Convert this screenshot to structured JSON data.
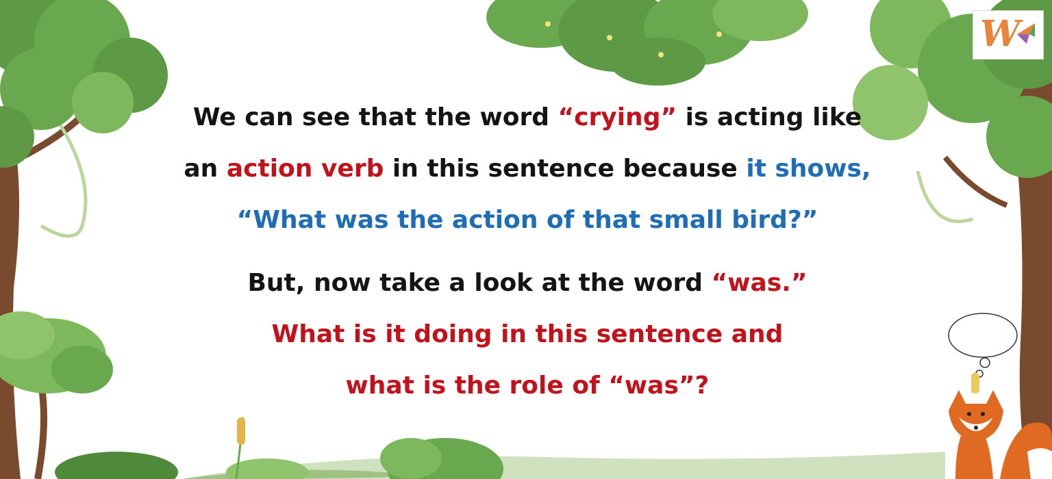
{
  "logo": {
    "letter": "W"
  },
  "text": {
    "line1": {
      "a": "We can see that the word ",
      "b": "“crying”",
      "c": " is acting like"
    },
    "line2": {
      "a": "an ",
      "b": "action verb",
      "c": " in this sentence because ",
      "d": "it shows,"
    },
    "line3": "“What was the action of that small bird?”",
    "line4": {
      "a": "But, now take a look at the word ",
      "b": "“was.”"
    },
    "line5": "What is it doing in this sentence and",
    "line6": "what is the role of “was”?"
  },
  "colors": {
    "text": "#141414",
    "highlight_red": "#c2121b",
    "highlight_blue": "#1f6db4",
    "foliage": "#6aa84f",
    "trunk": "#7a4a2e",
    "fox": "#e06a21"
  }
}
